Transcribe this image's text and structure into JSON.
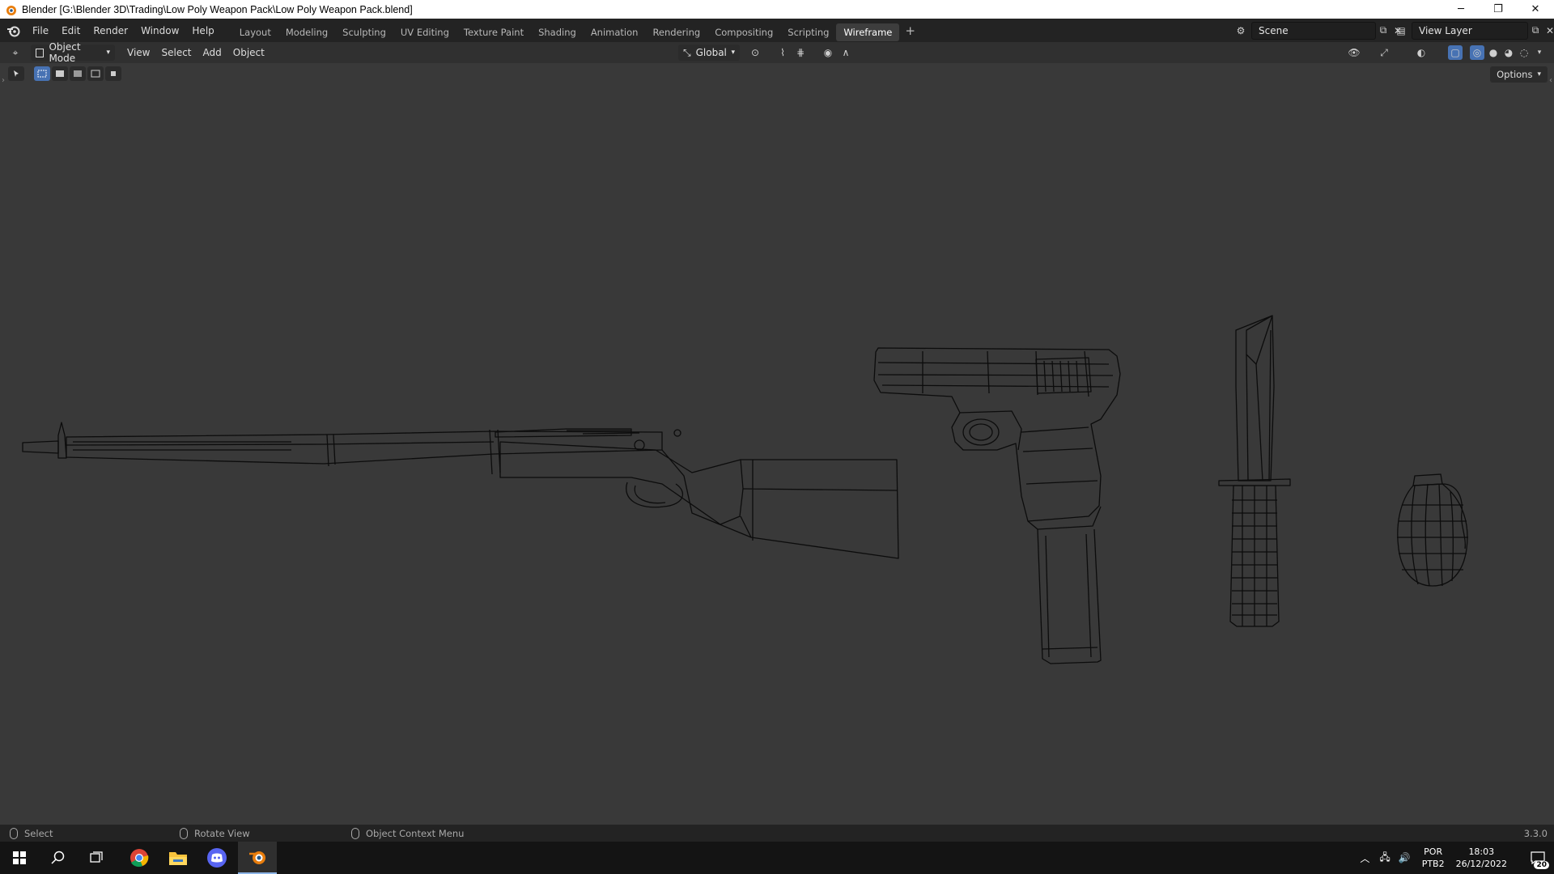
{
  "window": {
    "title": "Blender [G:\\Blender 3D\\Trading\\Low Poly Weapon Pack\\Low Poly Weapon Pack.blend]",
    "minimize": "─",
    "restore": "❐",
    "close": "✕"
  },
  "menu": {
    "items": [
      "File",
      "Edit",
      "Render",
      "Window",
      "Help"
    ]
  },
  "workspaces": {
    "tabs": [
      "Layout",
      "Modeling",
      "Sculpting",
      "UV Editing",
      "Texture Paint",
      "Shading",
      "Animation",
      "Rendering",
      "Compositing",
      "Scripting",
      "Wireframe"
    ],
    "active": "Wireframe",
    "add": "+"
  },
  "scene": {
    "label": "Scene"
  },
  "view_layer": {
    "label": "View Layer"
  },
  "header": {
    "mode": "Object Mode",
    "menus": [
      "View",
      "Select",
      "Add",
      "Object"
    ],
    "orientation": "Global"
  },
  "viewport": {
    "options": "Options",
    "objects": [
      "rifle",
      "pistol",
      "knife",
      "grenade"
    ],
    "bg_color": "#393939",
    "wire_color": "#0c0c0c"
  },
  "statusbar": {
    "select": "Select",
    "rotate": "Rotate View",
    "context": "Object Context Menu",
    "version": "3.3.0"
  },
  "taskbar": {
    "lang1": "POR",
    "lang2": "PTB2",
    "time": "18:03",
    "date": "26/12/2022",
    "notifications": "20"
  }
}
